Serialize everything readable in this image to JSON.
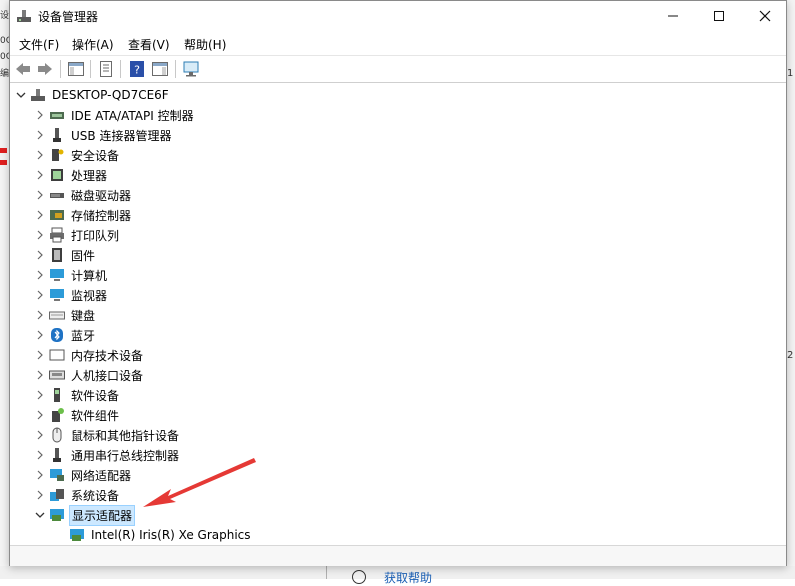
{
  "window": {
    "title": "设备管理器"
  },
  "menu": [
    "文件(F)",
    "操作(A)",
    "查看(V)",
    "帮助(H)"
  ],
  "toolbar": [
    {
      "name": "back-arrow-icon",
      "color": "#7a7a7a"
    },
    {
      "name": "forward-arrow-icon",
      "color": "#7a7a7a"
    },
    {
      "name": "console-tree-icon",
      "color": "#6b6b6b"
    },
    {
      "name": "properties-icon",
      "color": "#6b6b6b"
    },
    {
      "name": "help-icon",
      "color": "#2a4fa8"
    },
    {
      "name": "action-pane-icon",
      "color": "#6b6b6b"
    },
    {
      "name": "scan-hardware-icon",
      "color": "#2d7db3"
    }
  ],
  "tree": {
    "root": "DESKTOP-QD7CE6F",
    "categories": [
      {
        "label": "IDE ATA/ATAPI 控制器",
        "icon": "ide-controller-icon"
      },
      {
        "label": "USB 连接器管理器",
        "icon": "usb-icon"
      },
      {
        "label": "安全设备",
        "icon": "security-device-icon"
      },
      {
        "label": "处理器",
        "icon": "processor-icon"
      },
      {
        "label": "磁盘驱动器",
        "icon": "disk-drive-icon"
      },
      {
        "label": "存储控制器",
        "icon": "storage-controller-icon"
      },
      {
        "label": "打印队列",
        "icon": "printer-icon"
      },
      {
        "label": "固件",
        "icon": "firmware-icon"
      },
      {
        "label": "计算机",
        "icon": "computer-icon"
      },
      {
        "label": "监视器",
        "icon": "monitor-icon"
      },
      {
        "label": "键盘",
        "icon": "keyboard-icon"
      },
      {
        "label": "蓝牙",
        "icon": "bluetooth-icon"
      },
      {
        "label": "内存技术设备",
        "icon": "memory-device-icon"
      },
      {
        "label": "人机接口设备",
        "icon": "hid-icon"
      },
      {
        "label": "软件设备",
        "icon": "software-device-icon"
      },
      {
        "label": "软件组件",
        "icon": "software-component-icon"
      },
      {
        "label": "鼠标和其他指针设备",
        "icon": "mouse-icon"
      },
      {
        "label": "通用串行总线控制器",
        "icon": "usb-controller-icon"
      },
      {
        "label": "网络适配器",
        "icon": "network-adapter-icon"
      },
      {
        "label": "系统设备",
        "icon": "system-device-icon"
      },
      {
        "label": "显示适配器",
        "icon": "display-adapter-icon",
        "expanded": true,
        "selected": true
      }
    ],
    "child": {
      "label": "Intel(R) Iris(R) Xe Graphics",
      "icon": "display-adapter-icon"
    }
  },
  "background": {
    "help_link": "获取帮助",
    "left_fragments": [
      "设",
      "0C",
      "0C",
      "编"
    ],
    "right_fragments": [
      "1",
      "2"
    ]
  },
  "annotation": {
    "arrow_color": "#e53935"
  }
}
